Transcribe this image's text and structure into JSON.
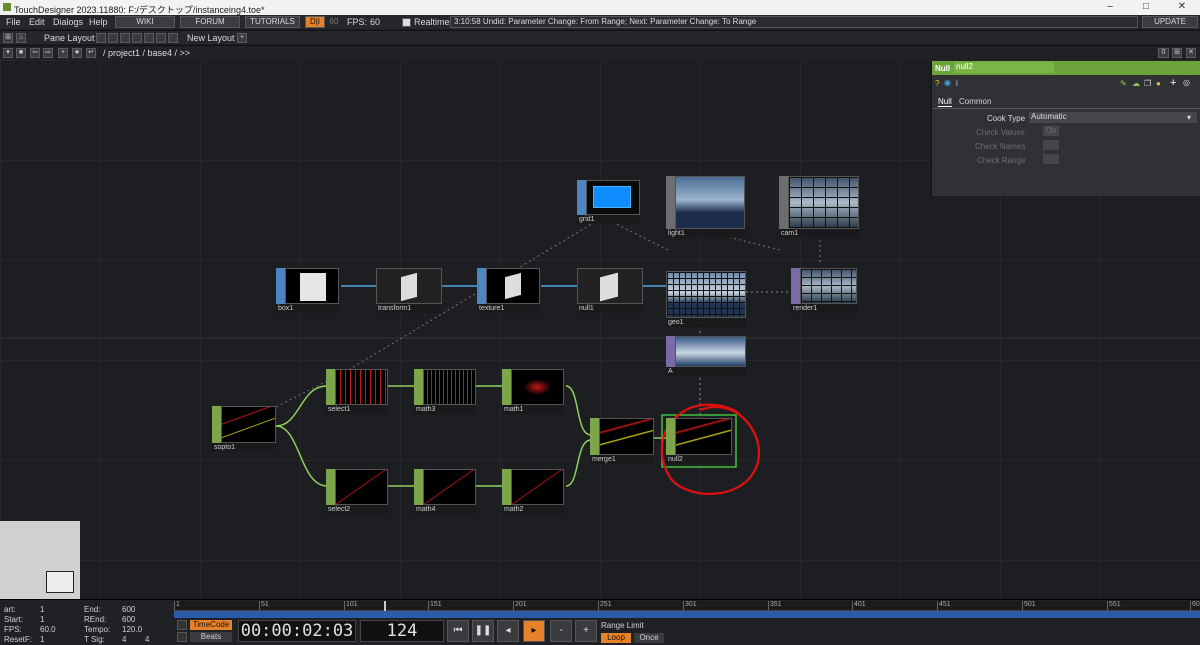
{
  "window": {
    "title": "TouchDesigner 2023.11880: F:/デスクトップ/instanceing4.toe*"
  },
  "menu": {
    "items": [
      "File",
      "Edit",
      "Dialogs",
      "Help"
    ],
    "wiki": "WIKI",
    "forum": "FORUM",
    "tutorials": "TUTORIALS",
    "fps_label": "FPS:",
    "fps_value": "60",
    "cook_value": "60",
    "realtime": "Realtime",
    "status": "3:10:58 Undid: Parameter Change: From Range; Next: Parameter Change: To Range",
    "update": "UPDATE",
    "perf": "D|I"
  },
  "toolbar": {
    "pane_layout": "Pane Layout",
    "new_layout": "New Layout",
    "plus": "+"
  },
  "path": {
    "text": "/ project1 / base4 / >>",
    "zero": "0"
  },
  "nodes": {
    "grid1": "grid1",
    "light1": "light1",
    "cam1": "cam1",
    "box1": "box1",
    "transform1": "transform1",
    "texture1": "texture1",
    "null1": "null1",
    "geo1": "geo1",
    "render1": "render1",
    "A": "A",
    "select1": "select1",
    "math3": "math3",
    "math1": "math1",
    "sopto1": "sopto1",
    "merge1": "merge1",
    "null2": "null2",
    "select2": "select2",
    "math4": "math4",
    "math2": "math2"
  },
  "params": {
    "family": "Null",
    "name": "null2",
    "tab_null": "Null",
    "tab_common": "Common",
    "cook_type_label": "Cook Type",
    "cook_type_value": "Automatic",
    "check_values": "Check Values",
    "check_values_v": "On",
    "check_names": "Check Names",
    "check_range": "Check Range"
  },
  "timeline": {
    "start_label": "art:",
    "start": "1",
    "rstart_label": "Start:",
    "rstart": "1",
    "fps_label": "FPS:",
    "fps": "60.0",
    "resetf_label": "ResetF:",
    "resetf": "1",
    "end_label": "End:",
    "end": "600",
    "rend_label": "REnd:",
    "rend": "600",
    "tempo_label": "Tempo:",
    "tempo": "120.0",
    "tsig_label": "T Sig:",
    "tsig_a": "4",
    "tsig_b": "4",
    "timecode": "TimeCode",
    "beats": "Beats",
    "time": "00:00:02:03",
    "frame": "124",
    "range_limit": "Range Limit",
    "loop": "Loop",
    "once": "Once",
    "minus": "-",
    "plus": "+",
    "ticks": [
      "1",
      "51",
      "101",
      "151",
      "201",
      "251",
      "301",
      "351",
      "401",
      "451",
      "501",
      "551",
      "600"
    ]
  },
  "colors": {
    "chop": "#7da64a",
    "sop": "#4b86c2",
    "top": "#7a6aa5",
    "accent": "#e8822a",
    "select": "#3fbf3f",
    "annotation": "#e01010"
  }
}
